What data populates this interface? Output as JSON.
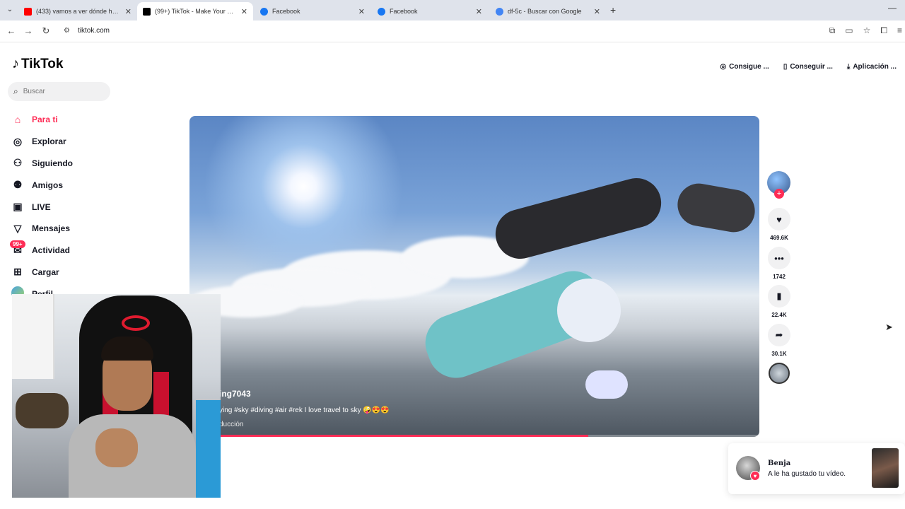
{
  "browser": {
    "tabs": [
      {
        "title": "(433) vamos a ver dónde hay f...",
        "favicon_color": "#ff0000"
      },
      {
        "title": "(99+) TikTok - Make Your Day",
        "favicon_color": "#000000"
      },
      {
        "title": "Facebook",
        "favicon_color": "#1877f2"
      },
      {
        "title": "Facebook",
        "favicon_color": "#1877f2"
      },
      {
        "title": "df-5c - Buscar con Google",
        "favicon_color": "#4285f4"
      }
    ],
    "url": "tiktok.com"
  },
  "tiktok": {
    "logo": "TikTok",
    "search_placeholder": "Buscar",
    "top_links": [
      "Consigue ...",
      "Conseguir ...",
      "Aplicación ..."
    ],
    "sidebar": [
      {
        "label": "Para ti",
        "icon": "home-icon",
        "active": true
      },
      {
        "label": "Explorar",
        "icon": "compass-icon",
        "active": false
      },
      {
        "label": "Siguiendo",
        "icon": "following-icon",
        "active": false
      },
      {
        "label": "Amigos",
        "icon": "friends-icon",
        "active": false
      },
      {
        "label": "LIVE",
        "icon": "live-icon",
        "active": false
      },
      {
        "label": "Mensajes",
        "icon": "messages-icon",
        "active": false
      },
      {
        "label": "Actividad",
        "icon": "activity-icon",
        "active": false,
        "badge": "99+"
      },
      {
        "label": "Cargar",
        "icon": "upload-icon",
        "active": false
      },
      {
        "label": "Perfil",
        "icon": "profile-icon",
        "active": false
      }
    ],
    "video": {
      "username": "ing7043",
      "description": "ying #sky #diving #air #rek I love travel to sky 🤪😍😍",
      "music": "ducción",
      "progress": 0.7
    },
    "actions": {
      "likes": "469.6K",
      "comments": "1742",
      "saves": "22.4K",
      "shares": "30.1K"
    },
    "notification": {
      "name": "Benja",
      "message": "A le ha gustado tu vídeo."
    }
  },
  "colors": {
    "accent": "#fe2c55"
  }
}
